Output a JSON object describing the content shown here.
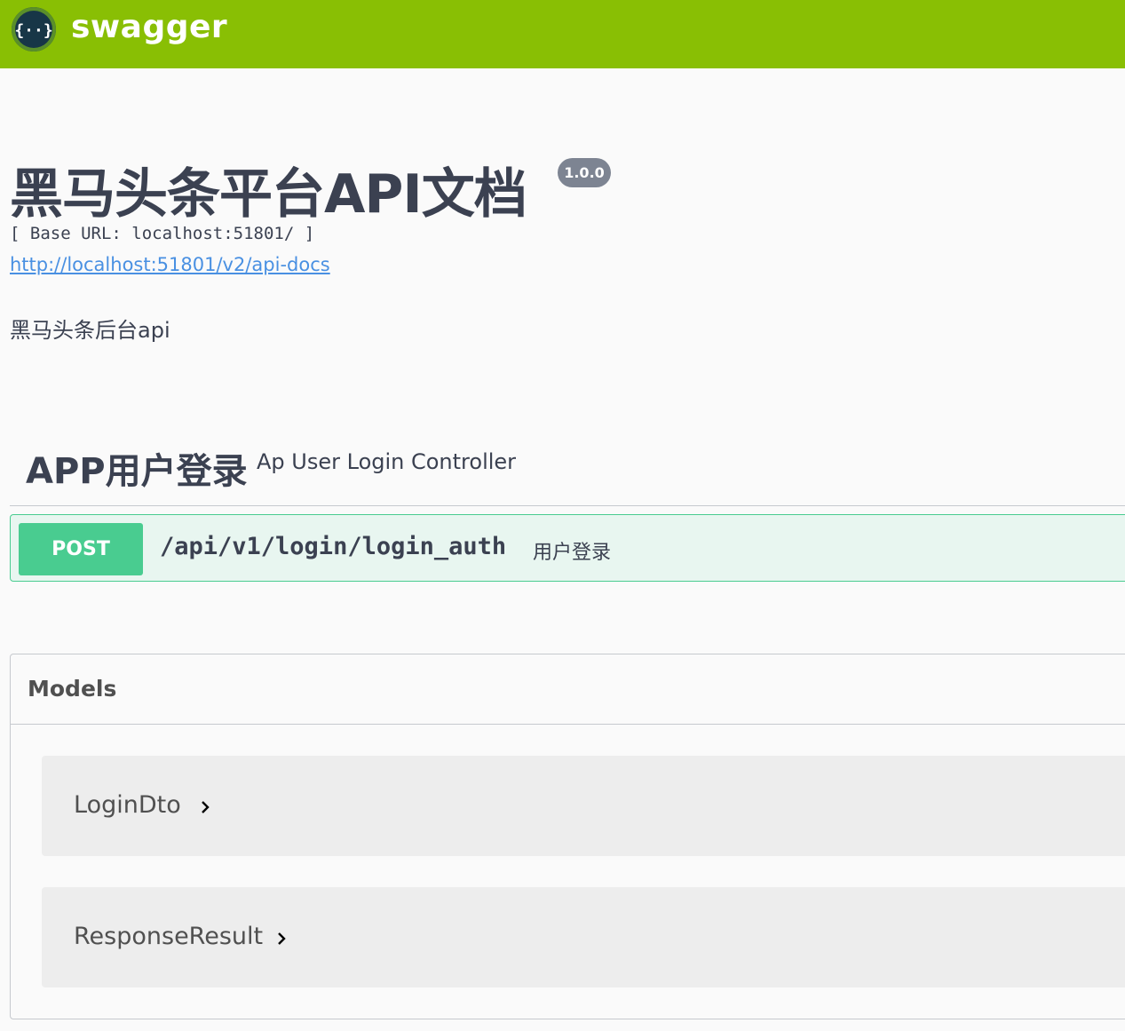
{
  "topbar": {
    "brand": "swagger",
    "logo_icon": "swagger-braces-icon",
    "background": "#89bf04"
  },
  "info": {
    "title": "黑马头条平台API文档",
    "version": "1.0.0",
    "base_url": "[ Base URL: localhost:51801/ ]",
    "docs_link": "http://localhost:51801/v2/api-docs",
    "description": "黑马头条后台api"
  },
  "tag": {
    "name": "APP用户登录",
    "description": "Ap User Login Controller"
  },
  "operation": {
    "method": "POST",
    "path": "/api/v1/login/login_auth",
    "summary": "用户登录",
    "method_color": "#49cc90"
  },
  "models": {
    "title": "Models",
    "items": [
      {
        "name": "LoginDto",
        "icon": "chevron-right-icon"
      },
      {
        "name": "ResponseResult",
        "icon": "chevron-right-icon"
      }
    ]
  }
}
